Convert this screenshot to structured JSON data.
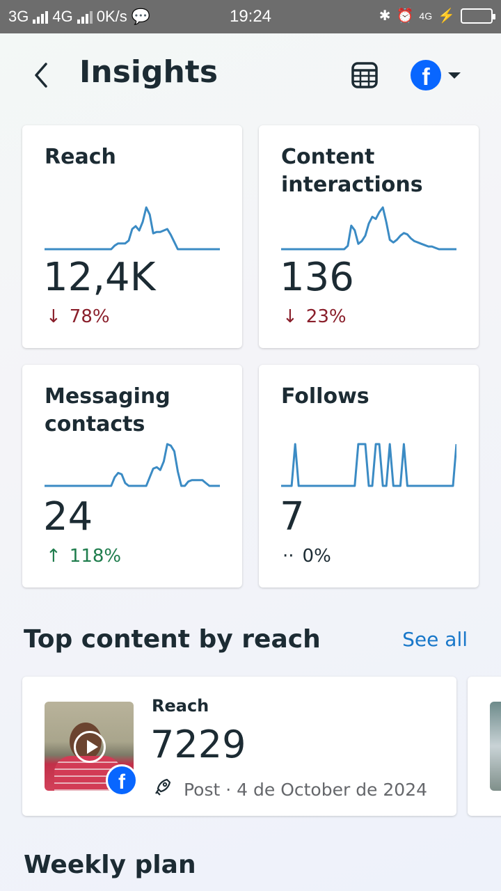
{
  "status_bar": {
    "network1": "3G",
    "network2": "4G",
    "speed": "0K/s",
    "time": "19:24",
    "net_small": "4G"
  },
  "header": {
    "title": "Insights",
    "icons": [
      "back-arrow-icon",
      "table-icon",
      "facebook-icon",
      "caret-down-icon"
    ]
  },
  "cards": [
    {
      "title": "Reach",
      "value": "12,4K",
      "delta": "78%",
      "direction": "down",
      "arrow": "↓",
      "trend": [
        0,
        0,
        0,
        0,
        0,
        0,
        0,
        0,
        0,
        0,
        0,
        0,
        0,
        0,
        0,
        0,
        0,
        0,
        0,
        0,
        5,
        8,
        8,
        8,
        12,
        28,
        32,
        26,
        38,
        58,
        48,
        22,
        24,
        24,
        26,
        28,
        20,
        10,
        0,
        0,
        0,
        0,
        0,
        0,
        0,
        0,
        0,
        0,
        0,
        0,
        0
      ]
    },
    {
      "title": "Content interactions",
      "value": "136",
      "delta": "23%",
      "direction": "down",
      "arrow": "↓",
      "trend": [
        0,
        0,
        0,
        0,
        0,
        0,
        0,
        0,
        0,
        0,
        0,
        0,
        0,
        0,
        0,
        0,
        0,
        0,
        0,
        5,
        35,
        28,
        8,
        12,
        20,
        38,
        48,
        45,
        55,
        62,
        40,
        14,
        10,
        14,
        20,
        24,
        22,
        16,
        12,
        10,
        8,
        6,
        4,
        4,
        2,
        0,
        0,
        0,
        0,
        0,
        0
      ]
    },
    {
      "title": "Messaging contacts",
      "value": "24",
      "delta": "118%",
      "direction": "up",
      "arrow": "↑",
      "trend": [
        0,
        0,
        0,
        0,
        0,
        0,
        0,
        0,
        0,
        0,
        0,
        0,
        0,
        0,
        0,
        0,
        0,
        0,
        0,
        0,
        12,
        18,
        16,
        4,
        0,
        0,
        0,
        0,
        0,
        0,
        12,
        24,
        26,
        22,
        34,
        58,
        56,
        48,
        20,
        0,
        0,
        6,
        8,
        8,
        8,
        8,
        4,
        0,
        0,
        0,
        0
      ]
    },
    {
      "title": "Follows",
      "value": "7",
      "delta": "0%",
      "direction": "neutral",
      "arrow": "··",
      "trend": [
        0,
        0,
        0,
        0,
        62,
        0,
        0,
        0,
        0,
        0,
        0,
        0,
        0,
        0,
        0,
        0,
        0,
        0,
        0,
        0,
        0,
        0,
        62,
        62,
        62,
        0,
        0,
        62,
        62,
        0,
        0,
        62,
        0,
        0,
        0,
        62,
        0,
        0,
        0,
        0,
        0,
        0,
        0,
        0,
        0,
        0,
        0,
        0,
        0,
        0,
        62
      ]
    }
  ],
  "top_content": {
    "title": "Top content by reach",
    "see_all": "See all",
    "item": {
      "label": "Reach",
      "value": "7229",
      "meta": "Post · 4 de October de 2024"
    }
  },
  "weekly_plan": {
    "title": "Weekly plan"
  },
  "colors": {
    "accent": "#0866ff",
    "sparkline": "#3b8bc4",
    "down": "#8a1f2b",
    "up": "#1f7d4d",
    "link": "#1877c9"
  }
}
